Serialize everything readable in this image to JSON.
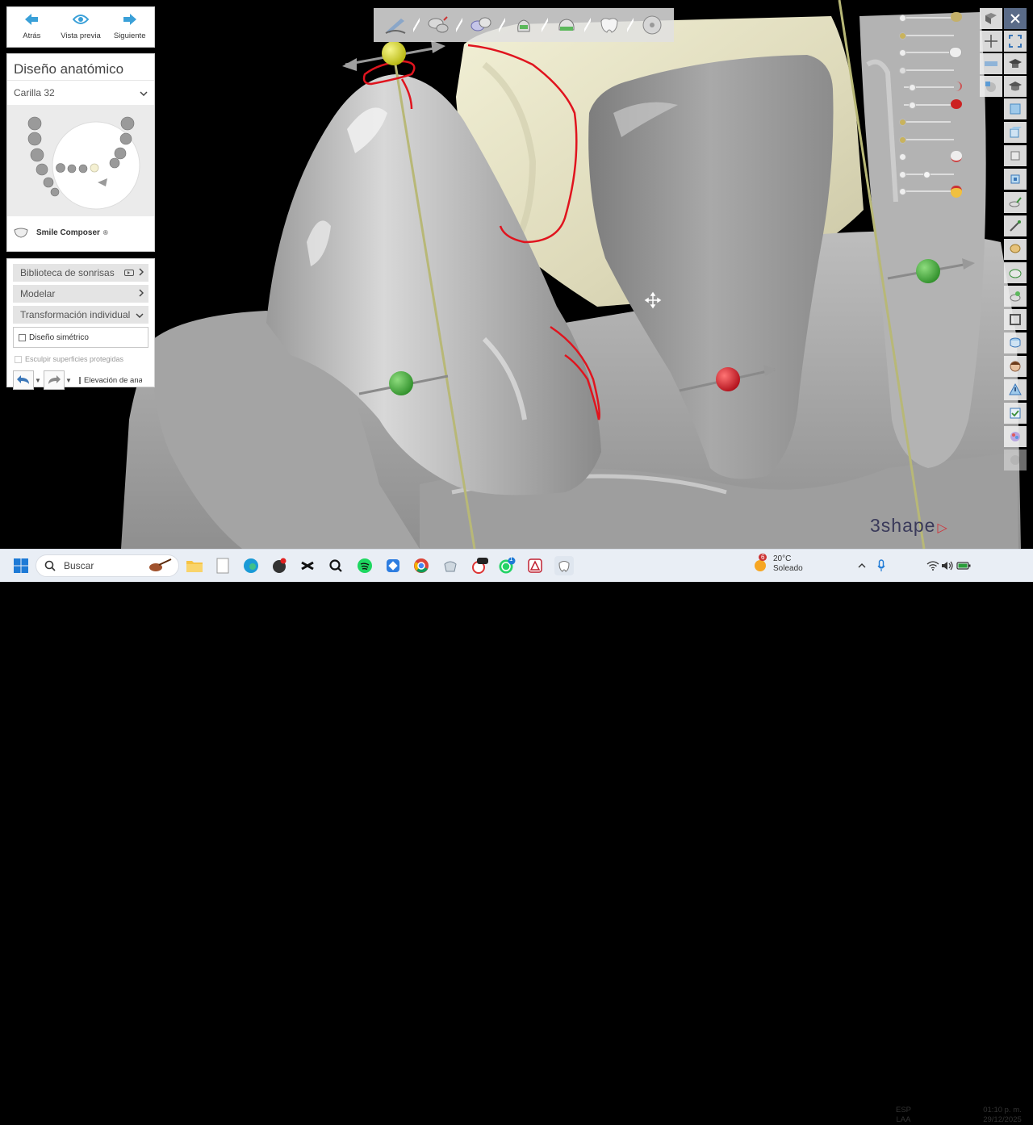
{
  "nav": {
    "back": "Atrás",
    "preview": "Vista previa",
    "next": "Siguiente"
  },
  "design": {
    "title": "Diseño anatómico",
    "restoration": "Carilla 32",
    "smile_composer": "Smile Composer",
    "registered": "®"
  },
  "tools": {
    "library": "Biblioteca de sonrisas",
    "model": "Modelar",
    "transform": "Transformación individual",
    "symmetric": "Diseño simétrico",
    "protected": "Esculpir superficies protegidas",
    "elevation": "Elevación de ana"
  },
  "logo": "3shape",
  "taskbar": {
    "search_placeholder": "Buscar",
    "weather_temp": "20°C",
    "weather_desc": "Soleado",
    "weather_badge": "6",
    "whatsapp_badge": "1",
    "lang_top": "ESP",
    "lang_bottom": "LAA",
    "time": "01:10 p. m.",
    "date": "29/12/2025"
  },
  "colors": {
    "accent_blue": "#3aa0d8",
    "margin_line": "#e0141e",
    "axis_line": "#b8b877",
    "logo": "#3a3a5a"
  }
}
